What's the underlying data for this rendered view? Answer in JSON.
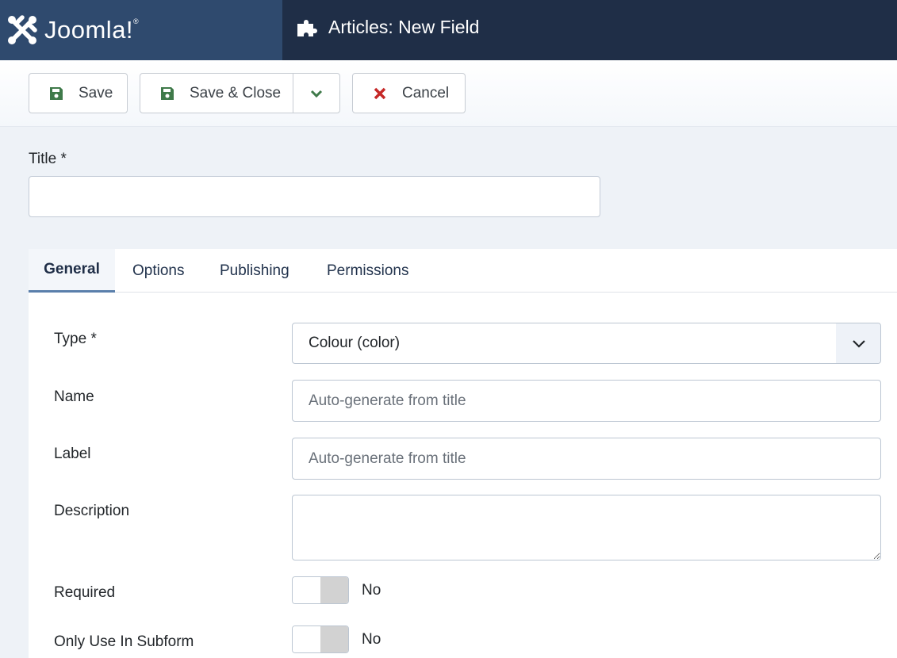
{
  "header": {
    "brand_name": "Joomla!",
    "brand_mark": "®",
    "page_title": "Articles: New Field",
    "page_icon": "puzzle-piece-icon"
  },
  "toolbar": {
    "save_label": "Save",
    "save_close_label": "Save & Close",
    "cancel_label": "Cancel",
    "icons": {
      "save": "floppy-disk-icon",
      "dropdown": "chevron-down-icon",
      "cancel": "x-icon"
    },
    "colors": {
      "save_icon": "#3f7a4a",
      "cancel_icon": "#c52827"
    }
  },
  "title_field": {
    "label": "Title *",
    "value": "",
    "placeholder": ""
  },
  "tabs": [
    {
      "label": "General",
      "active": true
    },
    {
      "label": "Options",
      "active": false
    },
    {
      "label": "Publishing",
      "active": false
    },
    {
      "label": "Permissions",
      "active": false
    }
  ],
  "general": {
    "type": {
      "label": "Type *",
      "selected": "Colour (color)"
    },
    "name": {
      "label": "Name",
      "value": "",
      "placeholder": "Auto-generate from title"
    },
    "field_label": {
      "label": "Label",
      "value": "",
      "placeholder": "Auto-generate from title"
    },
    "description": {
      "label": "Description",
      "value": ""
    },
    "required": {
      "label": "Required",
      "state": "No"
    },
    "only_subform": {
      "label": "Only Use In Subform",
      "state": "No"
    }
  }
}
